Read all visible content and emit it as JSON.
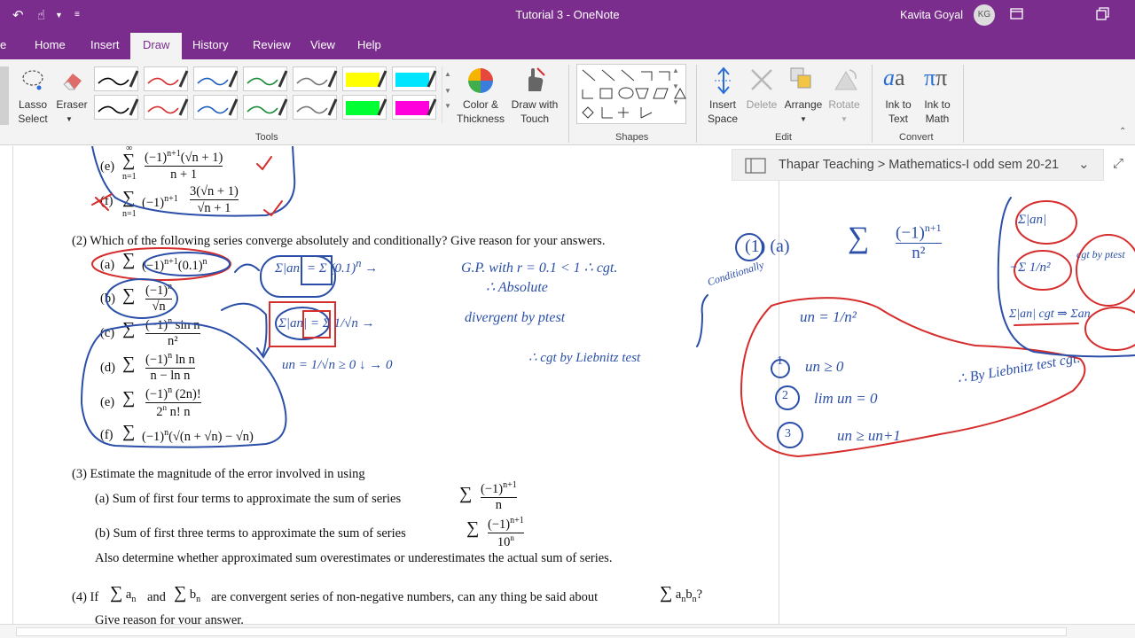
{
  "window": {
    "title": "Tutorial 3  -  OneNote",
    "user": "Kavita Goyal",
    "avatar_initials": "KG"
  },
  "tabs": [
    "Home",
    "Insert",
    "Draw",
    "History",
    "Review",
    "View",
    "Help"
  ],
  "active_tab": "Draw",
  "ribbon": {
    "lasso_label": "Lasso Select",
    "eraser_label": "Eraser",
    "tools_group": "Tools",
    "color_thickness_label": "Color & Thickness",
    "draw_with_touch_label": "Draw with Touch",
    "shapes_group": "Shapes",
    "insert_space_label": "Insert Space",
    "delete_label": "Delete",
    "arrange_label": "Arrange",
    "rotate_label": "Rotate",
    "edit_group": "Edit",
    "ink_to_text_label": "Ink to Text",
    "ink_to_math_label": "Ink to Math",
    "convert_group": "Convert",
    "pens": [
      {
        "color": "#000000"
      },
      {
        "color": "#d62d2d"
      },
      {
        "color": "#1f5fbf"
      },
      {
        "color": "#1a8a3a"
      },
      {
        "color": "#777777"
      },
      {
        "color": "#ffff00"
      },
      {
        "color": "#00e5ff"
      },
      {
        "color": "#000000"
      },
      {
        "color": "#d62d2d"
      },
      {
        "color": "#1f5fbf"
      },
      {
        "color": "#1a8a3a"
      },
      {
        "color": "#777777"
      },
      {
        "color": "#00ff33"
      },
      {
        "color": "#ff00dd"
      }
    ]
  },
  "breadcrumb": "Thapar Teaching > Mathematics-I odd sem 20-21",
  "document": {
    "q1e": "(e)",
    "q1f": "(f)",
    "q2": "(2) Which of the following series converge absolutely and conditionally? Give reason for your answers.",
    "q2_items": [
      "(a)",
      "(b)",
      "(c)",
      "(d)",
      "(e)",
      "(f)"
    ],
    "q3": "(3) Estimate the magnitude of the error involved in using",
    "q3a": "(a) Sum of first four terms to approximate the sum of series",
    "q3b": "(b) Sum of first three terms to approximate the sum of series",
    "q3c": "Also determine whether approximated sum overestimates or underestimates the actual sum of series.",
    "q4a": "(4) If",
    "q4b": "and",
    "q4c": "are convergent series of non-negative numbers, can any thing be said about",
    "q4d": "Give reason for your answer."
  },
  "ink": {
    "gp": "G.P. with r = 0.1 < 1   ∴ cgt.",
    "absolute": "∴ Absolute",
    "divergent": "divergent by ptest",
    "liebnitz": "∴ cgt by Liebnitz test",
    "conditionally": "Conditionally",
    "un": "un = 1/n²",
    "u1": "un ≥ 0",
    "u2": "lim un = 0",
    "u3": "un ≥ un+1",
    "by_liebnitz": "∴ By Liebnitz test cgt.",
    "part1": "(1) (a)",
    "ptest_small": "cgt by ptest"
  }
}
